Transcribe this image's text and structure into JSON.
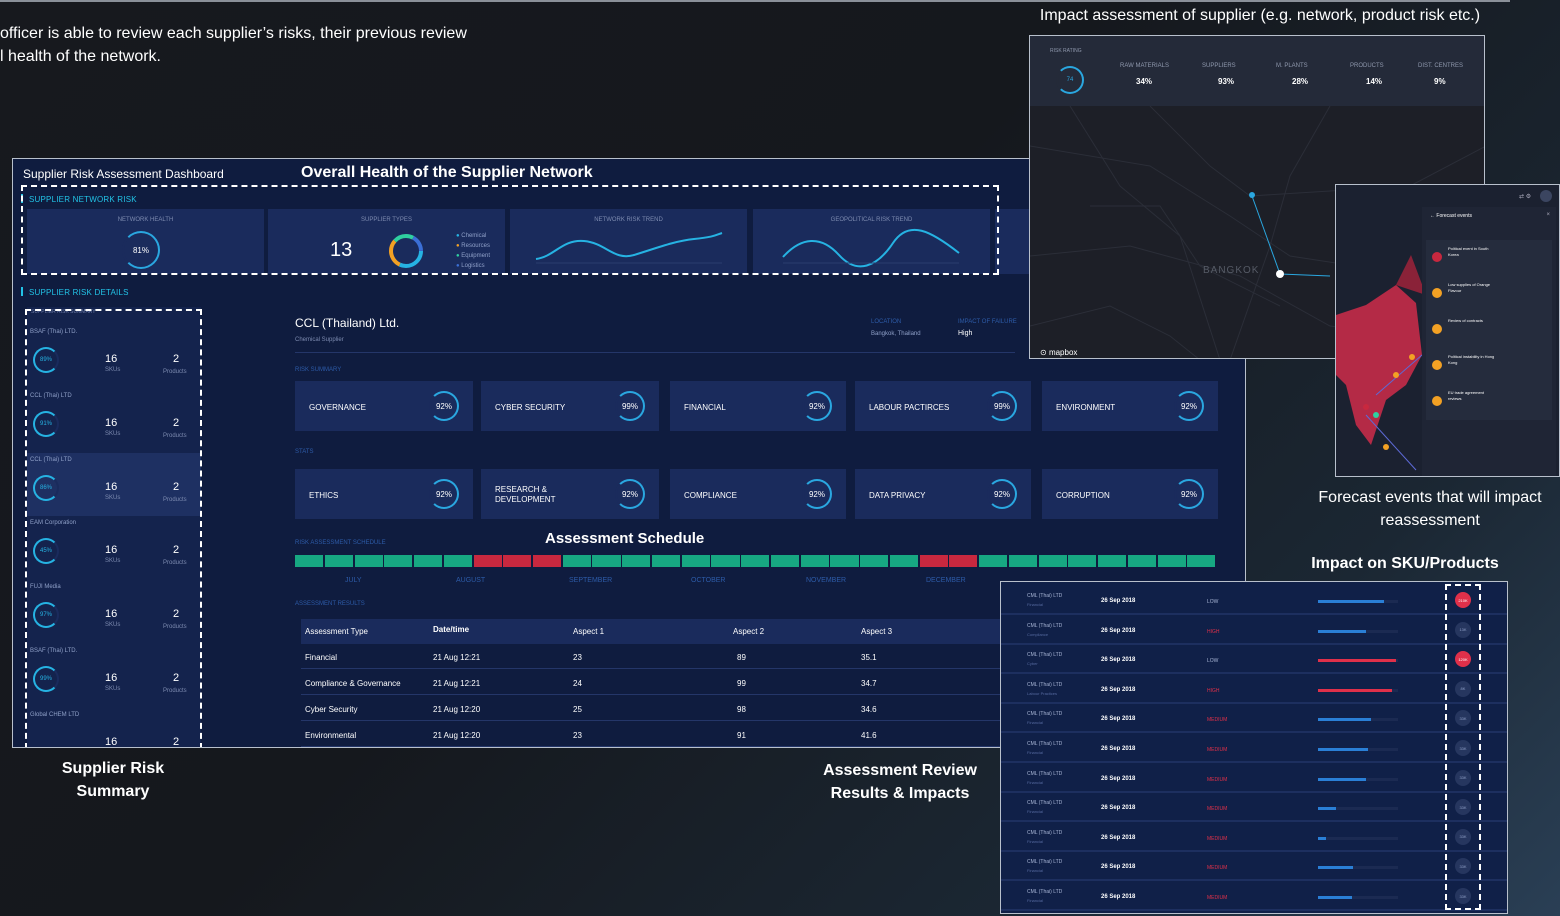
{
  "intro_lines": [
    "officer is able to review each supplier’s risks, their previous review",
    "l  health of the network."
  ],
  "captions": {
    "impact_assessment": "Impact assessment of supplier (e.g. network, product risk etc.)",
    "forecast": "Forecast events that will impact reassessment",
    "impact_sku": "Impact on SKU/Products",
    "supplier_risk_summary": "Supplier Risk Summary",
    "assessment_review": "Assessment Review Results & Impacts"
  },
  "dashboard": {
    "title": "Supplier Risk Assessment Dashboard",
    "overall_health_label": "Overall Health of the Supplier Network",
    "network_risk_label": "SUPPLIER NETWORK RISK",
    "details_label": "SUPPLIER RISK DETAILS",
    "kpis": {
      "network_health": {
        "caption": "NETWORK HEALTH",
        "value": "81%"
      },
      "supplier_types": {
        "caption": "SUPPLIER TYPES",
        "count": "13",
        "legend": [
          "Chemical",
          "Resources",
          "Equipment",
          "Logistics"
        ]
      },
      "network_risk_trend": {
        "caption": "NETWORK RISK TREND"
      },
      "geopolitical_risk_trend": {
        "caption": "GEOPOLITICAL RISK TREND"
      }
    },
    "supplier_list_header": "SUPPLIER RISK SUMMARY",
    "suppliers": [
      {
        "name": "BSAF (Thai) LTD.",
        "pct": "89%",
        "skus": "16",
        "skus_label": "SKUs",
        "products": "2",
        "products_label": "Products"
      },
      {
        "name": "CCL (Thai) LTD",
        "pct": "91%",
        "skus": "16",
        "skus_label": "SKUs",
        "products": "2",
        "products_label": "Products"
      },
      {
        "name": "CCL (Thai) LTD",
        "pct": "86%",
        "skus": "16",
        "skus_label": "SKUs",
        "products": "2",
        "products_label": "Products"
      },
      {
        "name": "EAM Corporation",
        "pct": "45%",
        "skus": "16",
        "skus_label": "SKUs",
        "products": "2",
        "products_label": "Products"
      },
      {
        "name": "FUJI Media",
        "pct": "97%",
        "skus": "16",
        "skus_label": "SKUs",
        "products": "2",
        "products_label": "Products"
      },
      {
        "name": "BSAF (Thai) LTD.",
        "pct": "99%",
        "skus": "16",
        "skus_label": "SKUs",
        "products": "2",
        "products_label": "Products"
      },
      {
        "name": "Global CHEM LTD",
        "pct": "",
        "skus": "16",
        "skus_label": "",
        "products": "2",
        "products_label": ""
      }
    ],
    "detail": {
      "company": "CCL (Thailand) Ltd.",
      "type": "Chemical Supplier",
      "location_label": "LOCATION",
      "location": "Bangkok, Thailand",
      "impact_label": "IMPACT OF FAILURE",
      "impact": "High",
      "risk_summary_label": "RISK SUMMARY",
      "stats_label": "STATS",
      "risk_summary": [
        {
          "label": "GOVERNANCE",
          "value": "92%"
        },
        {
          "label": "CYBER SECURITY",
          "value": "99%"
        },
        {
          "label": "FINANCIAL",
          "value": "92%"
        },
        {
          "label": "LABOUR PACTIRCES",
          "value": "99%"
        },
        {
          "label": "ENVIRONMENT",
          "value": "92%"
        }
      ],
      "stats": [
        {
          "label": "ETHICS",
          "value": "92%"
        },
        {
          "label": "RESEARCH & DEVELOPMENT",
          "value": "92%"
        },
        {
          "label": "COMPLIANCE",
          "value": "92%"
        },
        {
          "label": "DATA PRIVACY",
          "value": "92%"
        },
        {
          "label": "CORRUPTION",
          "value": "92%"
        }
      ],
      "schedule_label": "RISK ASSESSMENT SCHEDULE",
      "schedule_title": "Assessment Schedule",
      "months": [
        "JULY",
        "AUGUST",
        "SEPTEMBER",
        "OCTOBER",
        "NOVEMBER",
        "DECEMBER"
      ],
      "results_label": "ASSESSMENT RESULTS",
      "table_headers": [
        "Assessment Type",
        "Date/time",
        "Aspect 1",
        "Aspect 2",
        "Aspect 3"
      ],
      "table_rows": [
        [
          "Financial",
          "21 Aug 12:21",
          "23",
          "89",
          "35.1"
        ],
        [
          "Compliance & Governance",
          "21 Aug 12:21",
          "24",
          "99",
          "34.7"
        ],
        [
          "Cyber Security",
          "21 Aug 12:20",
          "25",
          "98",
          "34.6"
        ],
        [
          "Environmental",
          "21 Aug 12:20",
          "23",
          "91",
          "41.6"
        ]
      ]
    }
  },
  "map_panel": {
    "risk_rating_label": "RISK RATING",
    "risk_rating": "74",
    "metrics": [
      {
        "label": "RAW MATERIALS",
        "value": "34%"
      },
      {
        "label": "SUPPLIERS",
        "value": "93%"
      },
      {
        "label": "M. PLANTS",
        "value": "28%"
      },
      {
        "label": "PRODUCTS",
        "value": "14%"
      },
      {
        "label": "DIST. CENTRES",
        "value": "9%"
      }
    ],
    "city": "BANGKOK",
    "brand": "mapbox"
  },
  "forecast_panel": {
    "title": "Forecast events",
    "events": [
      "Political event in South Korea",
      "Low supplies of Orange Flavour",
      "Review of contracts",
      "Political instability in Hong Kong",
      "EU trade agreement reviews"
    ],
    "colors": {
      "red": "#c8283f",
      "orange": "#f3a124"
    }
  },
  "sku_panel": {
    "rows": [
      {
        "supplier": "CML (Thai) LTD",
        "sub": "Financial",
        "date": "26 Sep 2018",
        "level": "LOW",
        "bar": 0.82,
        "badge": "210K",
        "hot": true
      },
      {
        "supplier": "CML (Thai) LTD",
        "sub": "Compliance",
        "date": "26 Sep 2018",
        "level": "HIGH",
        "bar": 0.6,
        "badge": "13K",
        "hot": false
      },
      {
        "supplier": "CML (Thai) LTD",
        "sub": "Cyber",
        "date": "26 Sep 2018",
        "level": "LOW",
        "bar": 0.98,
        "badge": "120K",
        "hot": true
      },
      {
        "supplier": "CML (Thai) LTD",
        "sub": "Labour Practices",
        "date": "26 Sep 2018",
        "level": "HIGH",
        "bar": 0.92,
        "badge": "8K",
        "hot": false
      },
      {
        "supplier": "CML (Thai) LTD",
        "sub": "Financial",
        "date": "26 Sep 2018",
        "level": "MEDIUM",
        "bar": 0.66,
        "badge": "33K",
        "hot": false
      },
      {
        "supplier": "CML (Thai) LTD",
        "sub": "Financial",
        "date": "26 Sep 2018",
        "level": "MEDIUM",
        "bar": 0.62,
        "badge": "33K",
        "hot": false
      },
      {
        "supplier": "CML (Thai) LTD",
        "sub": "Financial",
        "date": "26 Sep 2018",
        "level": "MEDIUM",
        "bar": 0.6,
        "badge": "33K",
        "hot": false
      },
      {
        "supplier": "CML (Thai) LTD",
        "sub": "Financial",
        "date": "26 Sep 2018",
        "level": "MEDIUM",
        "bar": 0.22,
        "badge": "33K",
        "hot": false
      },
      {
        "supplier": "CML (Thai) LTD",
        "sub": "Financial",
        "date": "26 Sep 2018",
        "level": "MEDIUM",
        "bar": 0.1,
        "badge": "33K",
        "hot": false
      },
      {
        "supplier": "CML (Thai) LTD",
        "sub": "Financial",
        "date": "26 Sep 2018",
        "level": "MEDIUM",
        "bar": 0.44,
        "badge": "33K",
        "hot": false
      },
      {
        "supplier": "CML (Thai) LTD",
        "sub": "Financial",
        "date": "26 Sep 2018",
        "level": "MEDIUM",
        "bar": 0.42,
        "badge": "33K",
        "hot": false
      }
    ]
  },
  "colors": {
    "accent": "#22c3e6",
    "risk_high": "#e0304a",
    "schedule_ok": "#17a882",
    "schedule_alert": "#c8283f"
  }
}
